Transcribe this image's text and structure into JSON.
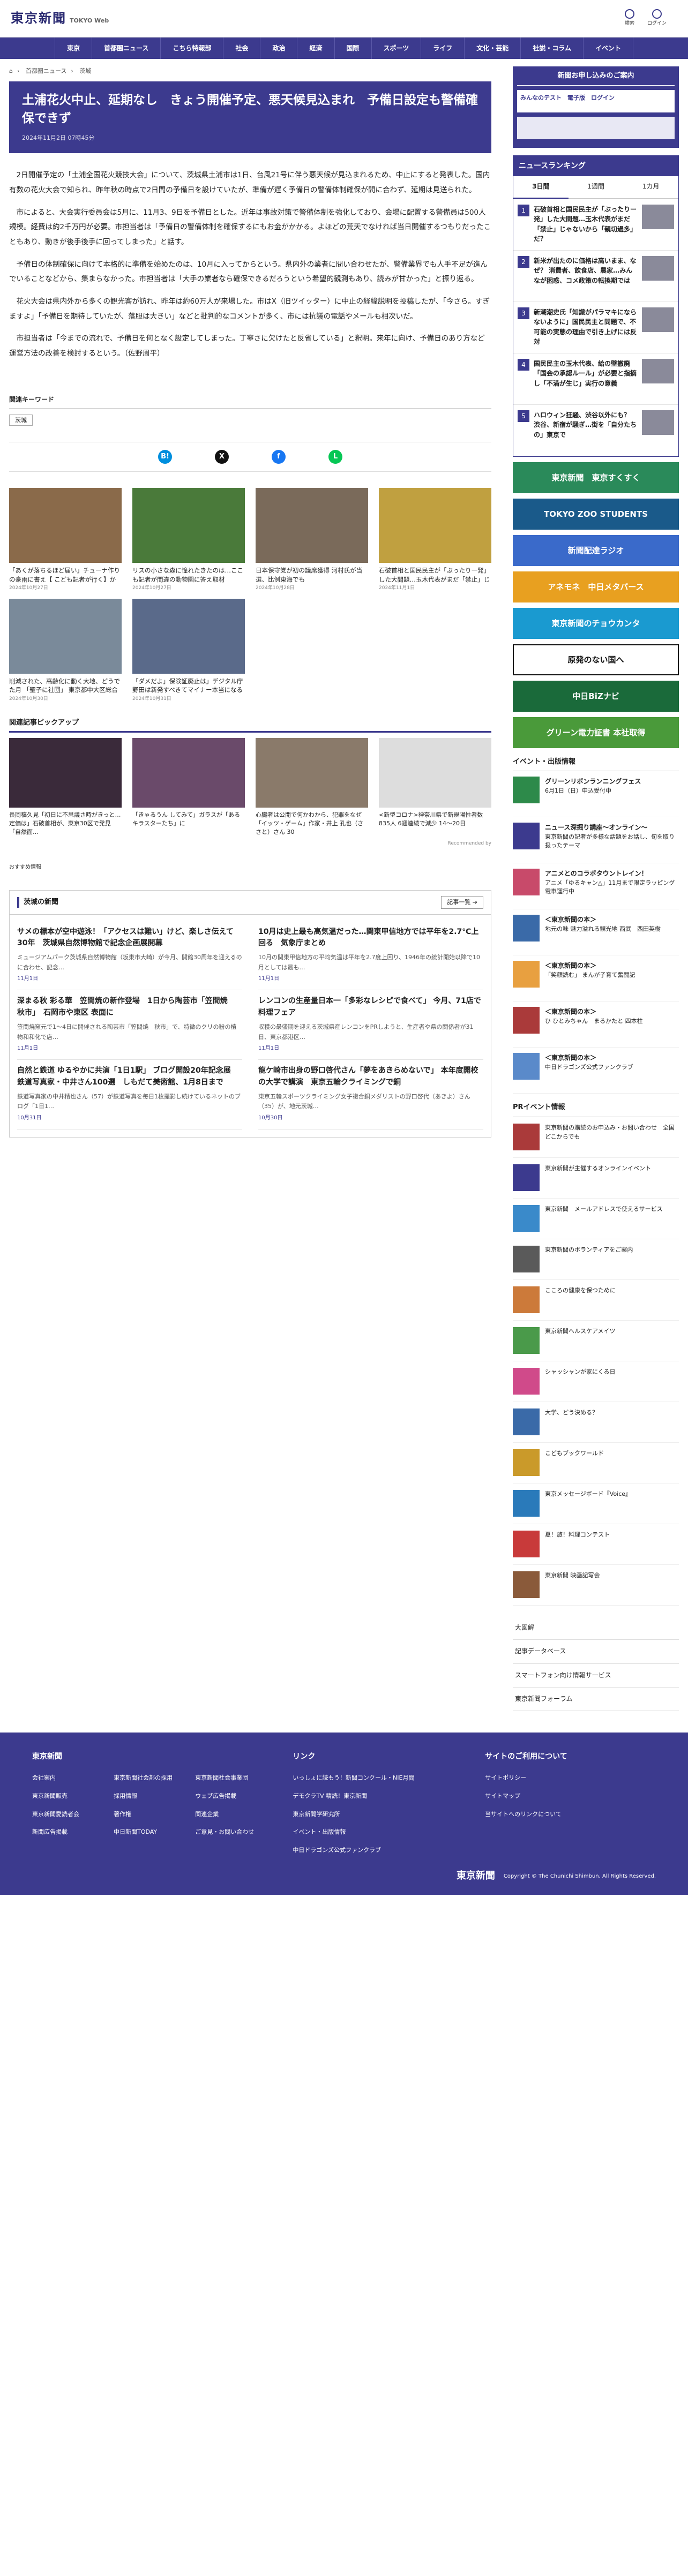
{
  "site": {
    "logo": "東京新聞",
    "logo_sub": "TOKYO Web",
    "icons": [
      {
        "label": "検索"
      },
      {
        "label": "ログイン"
      }
    ]
  },
  "nav": [
    "東京",
    "首都圏ニュース",
    "こちら特報部",
    "社会",
    "政治",
    "経済",
    "国際",
    "スポーツ",
    "ライフ",
    "文化・芸能",
    "社説・コラム",
    "イベント"
  ],
  "breadcrumb": [
    "首都圏ニュース",
    "茨城"
  ],
  "article": {
    "title": "土浦花火中止、延期なし　きょう開催予定、悪天候見込まれ　予備日設定も警備確保できず",
    "date": "2024年11月2日 07時45分",
    "paragraphs": [
      "2日開催予定の「土浦全国花火競技大会」について、茨城県土浦市は1日、台風21号に伴う悪天候が見込まれるため、中止にすると発表した。国内有数の花火大会で知られ、昨年秋の時点で2日間の予備日を設けていたが、準備が遅く予備日の警備体制確保が間に合わず、延期は見送られた。",
      "市によると、大会実行委員会は5月に、11月3、9日を予備日とした。近年は事故対策で警備体制を強化しており、会場に配置する警備員は500人規模。経費は約2千万円が必要。市担当者は「予備日の警備体制を確保するにもお金がかかる。よほどの荒天でなければ当日開催するつもりだったこともあり、動きが後手後手に回ってしまった」と話す。",
      "予備日の体制確保に向けて本格的に準備を始めたのは、10月に入ってからという。県内外の業者に問い合わせたが、警備業界でも人手不足が進んでいることなどから、集まらなかった。市担当者は「大手の業者なら確保できるだろうという希望的観測もあり、読みが甘かった」と振り返る。",
      "花火大会は県内外から多くの観光客が訪れ、昨年は約60万人が来場した。市はX（旧ツイッター）に中止の経緯説明を投稿したが、「今さら。すぎますよ」「予備日を期待していたが、落胆は大きい」などと批判的なコメントが多く、市には抗議の電話やメールも相次いだ。",
      "市担当者は「今までの流れで、予備日を何となく設定してしまった。丁寧さに欠けたと反省している」と釈明。来年に向け、予備日のあり方など運営方法の改善を検討するという。（佐野周平）"
    ]
  },
  "keywords": {
    "heading": "関連キーワード",
    "tags": [
      "茨城"
    ]
  },
  "share": [
    {
      "icon": "hatena-icon",
      "glyph": "B!",
      "color": "#008fde"
    },
    {
      "icon": "x-icon",
      "glyph": "X",
      "color": "#111111"
    },
    {
      "icon": "facebook-icon",
      "glyph": "f",
      "color": "#1877f2"
    },
    {
      "icon": "line-icon",
      "glyph": "L",
      "color": "#06c755"
    }
  ],
  "related": [
    {
      "text": "「あくが落ちるほど届い」チューナ作りの豪雨に書え【 こども記者が行く】かつけりも家編記",
      "date": "2024年10月27日",
      "color": "#8a6a4a"
    },
    {
      "text": "リスの小さな森に憧れたきたのは…ここも記者が間違の動物園に答え取材",
      "date": "2024年10月27日",
      "color": "#4a7a3a"
    },
    {
      "text": "日本保守党が初の議席獲得 河村氏が当選、比例東海でも",
      "date": "2024年10月28日",
      "color": "#7a6a5a"
    },
    {
      "text": "石破首相と国民民主が「ぶったりー発」した大間題…玉木代表がまだ「禁止」じゃないから何を言",
      "date": "2024年11月1日",
      "color": "#c0a040"
    },
    {
      "text": "削減された、高齢化に動く大地、どうでた月 「聖子に社団」 東京都中大区総合",
      "date": "2024年10月30日",
      "color": "#7a8a9a"
    },
    {
      "text": "「ダメだよ」保険証廃止は」デジタル庁野田は新発すべきてマイナー本当になるかの",
      "date": "2024年10月31日",
      "color": "#5a6a8a"
    }
  ],
  "pickup": {
    "heading": "関連記事ピックアップ",
    "items": [
      {
        "text": "長岡稿久見「初日に不思議さ時がきっと…定価は」石破首相が、東京30区で発見「自然面…",
        "color": "#3a2a3a"
      },
      {
        "text": "「きゃるうん してみて」ガラスが「あるキラスターたち」に",
        "color": "#6a4a6a"
      },
      {
        "text": "心臓者は公開で何かわから、犯罪をなぜ「イッツ・ゲーム」作家・井上 孔也（ささと）さん 30",
        "color": "#8a7a6a"
      },
      {
        "text": "<新型コロナ>神奈川県で新規陽性者数835人 6週連続で減少 14〜20日",
        "color": "#dddddd"
      }
    ],
    "recommended": "Recommended by"
  },
  "sub_label": "おすすめ情報",
  "ibaraki": {
    "heading": "茨城の新聞",
    "more": "記事一覧 ➔",
    "items": [
      {
        "title": "サメの標本が空中遊泳！「アクセスは難い」けど、楽しさ伝えて30年　茨城県自然博物館で記念企画展開幕",
        "desc": "ミュージアムパーク茨城県自然博物館（坂東市大崎）が今月、開館30周年を迎えるのに合わせ、記念…",
        "date": "11月1日"
      },
      {
        "title": "10月は史上最も高気温だった…関東甲信地方では平年を2.7℃上回る　気象庁まとめ",
        "desc": "10月の関東甲信地方の平均気温は平年を2.7度上回り、1946年の統計開始以降で10月としては最も…",
        "date": "11月1日"
      },
      {
        "title": "深まる秋 彩る華　笠間焼の新作登場　1日から陶芸市「笠間焼　秋市」　石岡市や東区 表面に",
        "desc": "笠間焼窯元で1〜4日に開催される陶芸市「笠間焼　秋市」で、特徴のクリの粉の植物和和化で店…",
        "date": "11月1日"
      },
      {
        "title": "レンコンの生産量日本一「多彩なレシピで食べて」 今月、71店で料理フェア",
        "desc": "収穫の最盛期を迎える茨城県産レンコンをPRしようと、生産者や県の関係者が31日、東京都港区…",
        "date": "11月1日"
      },
      {
        "title": "自然と鉄道 ゆるやかに共演「1日1駅」 ブログ開設20年記念展　鉄道写真家・中井さん100選　しもだて美術館、1月8日まで",
        "desc": "鉄道写真家の中井精也さん（57）が鉄道写真を毎日1枚撮影し続けているネットのブログ「1日1…",
        "date": "10月31日"
      },
      {
        "title": "龍ケ崎市出身の野口啓代さん「夢をあきらめないで」 本年度開校の大学で講演　東京五輪クライミングで銅",
        "desc": "東京五輪スポーツクライミング女子複合銅メダリストの野口啓代（あきよ）さん（35）が、地元茨城…",
        "date": "10月30日"
      }
    ]
  },
  "side": {
    "banner_title": "新聞お申し込みのご案内",
    "banner_sub": "みんなのテスト　電子版　ログイン",
    "ranking_heading": "ニュースランキング",
    "ranking_tabs": [
      "3日間",
      "1週間",
      "1カ月"
    ],
    "ranking": [
      {
        "n": "1",
        "text": "石破首相と国民民主が「ぶったりー発」した大間題…玉木代表がまだ「禁止」じゃないから「親切過多」だ？"
      },
      {
        "n": "2",
        "text": "新米が出たのに価格は高いまま、なぜ？ 消費者、飲食店、農家…みんなが困惑、コメ政策の転換期では"
      },
      {
        "n": "3",
        "text": "新潮潮史氏「知識がパラマキにならないように」国民民主と問題で、不可能の実態の理由で引き上げには反対"
      },
      {
        "n": "4",
        "text": "国民民主の玉木代表、給の壁撤廃「国会の承認ルール」が必要と指摘し「不満が生じ」実行の意義"
      },
      {
        "n": "5",
        "text": "ハロウィン狂騒、渋谷以外にも？ 渋谷、新宿が騒ぎ…街を「自分たちの」東京で"
      }
    ],
    "event_heading": "イベント・出版情報",
    "events": [
      {
        "title": "グリーンリボンランニングフェス",
        "desc": "6月1日（日）申込受付中",
        "color": "#2d8a4a"
      },
      {
        "title": "ニュース深掘り講座〜オンライン〜",
        "desc": "東京新聞の記者が多様な話題をお話し、旬を取り扱ったテーマ",
        "color": "#3c3a8e"
      },
      {
        "title": "アニメとのコラボタウントレイン！",
        "desc": "アニメ「ゆるキャン△」11月まで限定ラッピング電車運行中",
        "color": "#c84a6a"
      },
      {
        "title": "＜東京新聞の本＞",
        "desc": "地元の味 魅力溢れる観光地 西武　西田英樹",
        "color": "#3a6aa8"
      },
      {
        "title": "＜東京新聞の本＞",
        "desc": "「笑顔読む」 まんが子育て奮闘記",
        "color": "#e8a040"
      },
      {
        "title": "＜東京新聞の本＞",
        "desc": "ひ ひとみちゃん　まるかたと 四本柱",
        "color": "#aa3a3a"
      },
      {
        "title": "＜東京新聞の本＞",
        "desc": "中日ドラゴンズ公式ファンクラブ",
        "color": "#5a8aca"
      }
    ],
    "pr_heading": "PRイベント情報",
    "pr": [
      {
        "text": "東京新聞の購読のお申込み・お問い合わせ　全国どこからでも",
        "color": "#aa3a3a"
      },
      {
        "text": "東京新聞が主催するオンラインイベント",
        "color": "#3c3a8e"
      },
      {
        "text": "東京新聞　メールアドレスで使えるサービス",
        "color": "#3a8aca"
      },
      {
        "text": "東京新聞のボランティアをご案内",
        "color": "#5a5a5a"
      },
      {
        "text": "こころの健康を保つために",
        "color": "#cc7a3a"
      },
      {
        "text": "東京新聞ヘルスケアメイツ",
        "color": "#4a9a4a"
      },
      {
        "text": "シャッシャンが家にくる日",
        "color": "#d04a8a"
      },
      {
        "text": "大学、どう決める？",
        "color": "#3a6aa8"
      },
      {
        "text": "こどもブックワールド",
        "color": "#ca9a2a"
      },
      {
        "text": "東京メッセージボード『Voice』",
        "color": "#2a7aba"
      },
      {
        "text": "夏！旅！料理コンテスト",
        "color": "#c83a3a"
      },
      {
        "text": "東京新聞 映画記写会",
        "color": "#8a5a3a"
      }
    ],
    "side_links": [
      "大図解",
      "記事データベース",
      "スマートフォン向け情報サービス",
      "東京新聞フォーラム"
    ],
    "ads": [
      {
        "text": "東京新聞　東京すくすく",
        "color": "#2a8a5a"
      },
      {
        "text": "TOKYO ZOO STUDENTS",
        "color": "#1a5a8a"
      },
      {
        "text": "新聞配達ラジオ",
        "color": "#3a6aca"
      },
      {
        "text": "アネモネ　中日メタバース",
        "color": "#e8a020"
      },
      {
        "text": "東京新聞のチョウカンタ",
        "color": "#1a9ad0"
      },
      {
        "text": "原発のない国へ",
        "color": "#ffffff"
      },
      {
        "text": "中日BiZナビ",
        "color": "#1a6a3a"
      },
      {
        "text": "グリーン電力証書 本社取得",
        "color": "#4a9a3a"
      }
    ]
  },
  "footer": {
    "col1_heading": "東京新聞",
    "col1": [
      "会社案内",
      "東京新聞社会部の採用",
      "東京新聞社会事業団",
      "東京新聞販売",
      "採用情報",
      "ウェブ広告掲載",
      "東京新聞愛読者会",
      "著作権",
      "関連企業",
      "新聞広告掲載",
      "中日新聞TODAY",
      "ご意見・お問い合わせ"
    ],
    "col2_heading": "リンク",
    "col2": [
      "いっしょに読もう！新聞コンクール・NIE月間",
      "デモクラTV 精読！東京新聞",
      "東京新聞学研究所",
      "イベント・出版情報",
      "中日ドラゴンズ公式ファンクラブ"
    ],
    "col3_heading": "サイトのご利用について",
    "col3": [
      "サイトポリシー",
      "サイトマップ",
      "当サイトへのリンクについて"
    ],
    "logo": "東京新聞",
    "copyright": "Copyright © The Chunichi Shimbun, All Rights Reserved."
  }
}
